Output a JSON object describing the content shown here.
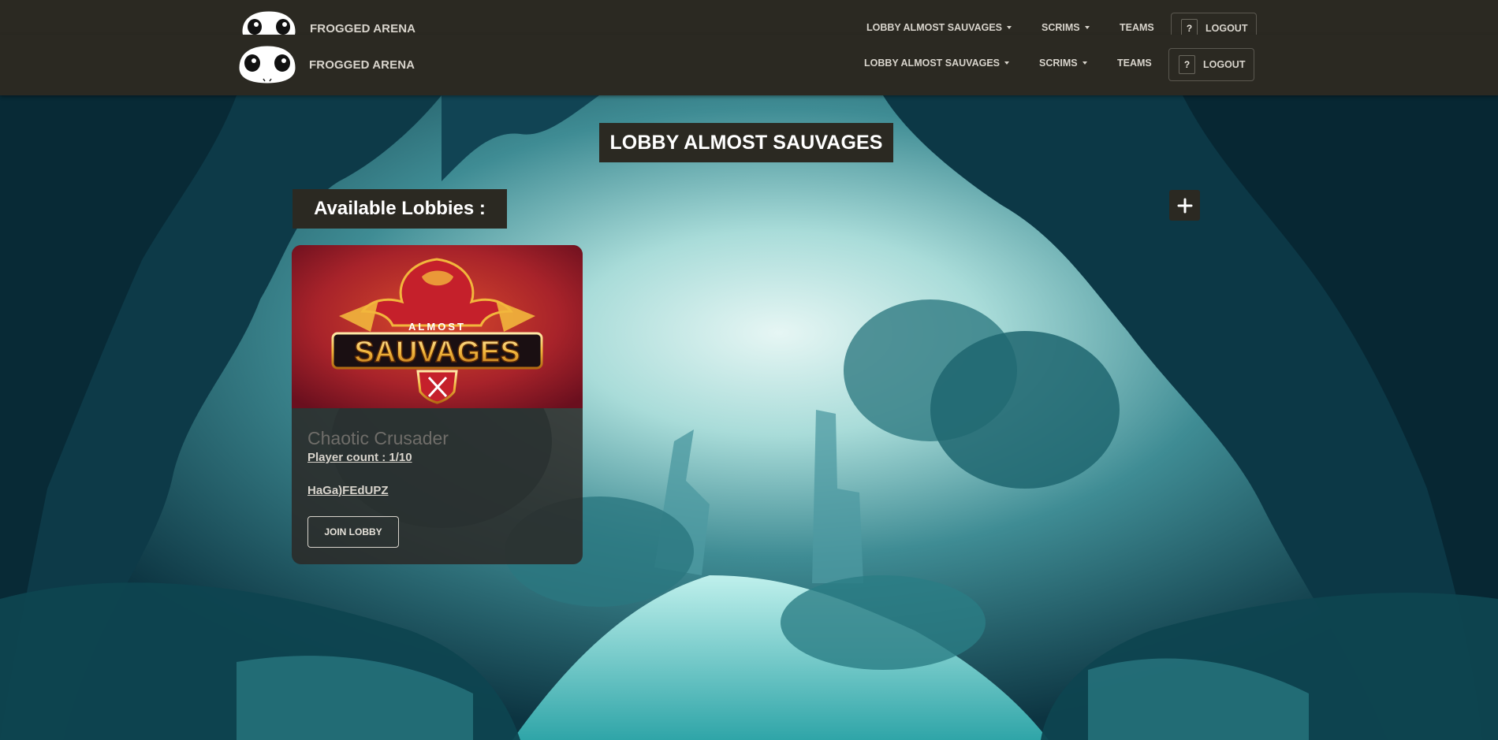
{
  "navbar": {
    "brand": "FROGGED ARENA",
    "lobby_menu": "LOBBY ALMOST SAUVAGES",
    "scrims_menu": "SCRIMS",
    "teams_link": "TEAMS",
    "help_icon": "?",
    "logout_label": "LOGOUT"
  },
  "main": {
    "page_title": "LOBBY ALMOST SAUVAGES",
    "section_title": "Available Lobbies :",
    "add_button_icon": "plus-icon"
  },
  "lobbies": [
    {
      "image": {
        "top_text": "ALMOST",
        "main_text": "SAUVAGES"
      },
      "name": "Chaotic Crusader",
      "player_count": "Player count : 1/10",
      "code": "HaGa)FEdUPZ",
      "join_label": "JOIN LOBBY"
    }
  ],
  "colors": {
    "navbar": "#2b2922",
    "nav_text": "#d8d4cc",
    "title_box": "#2b2922",
    "card_bg": "#2b2926"
  }
}
